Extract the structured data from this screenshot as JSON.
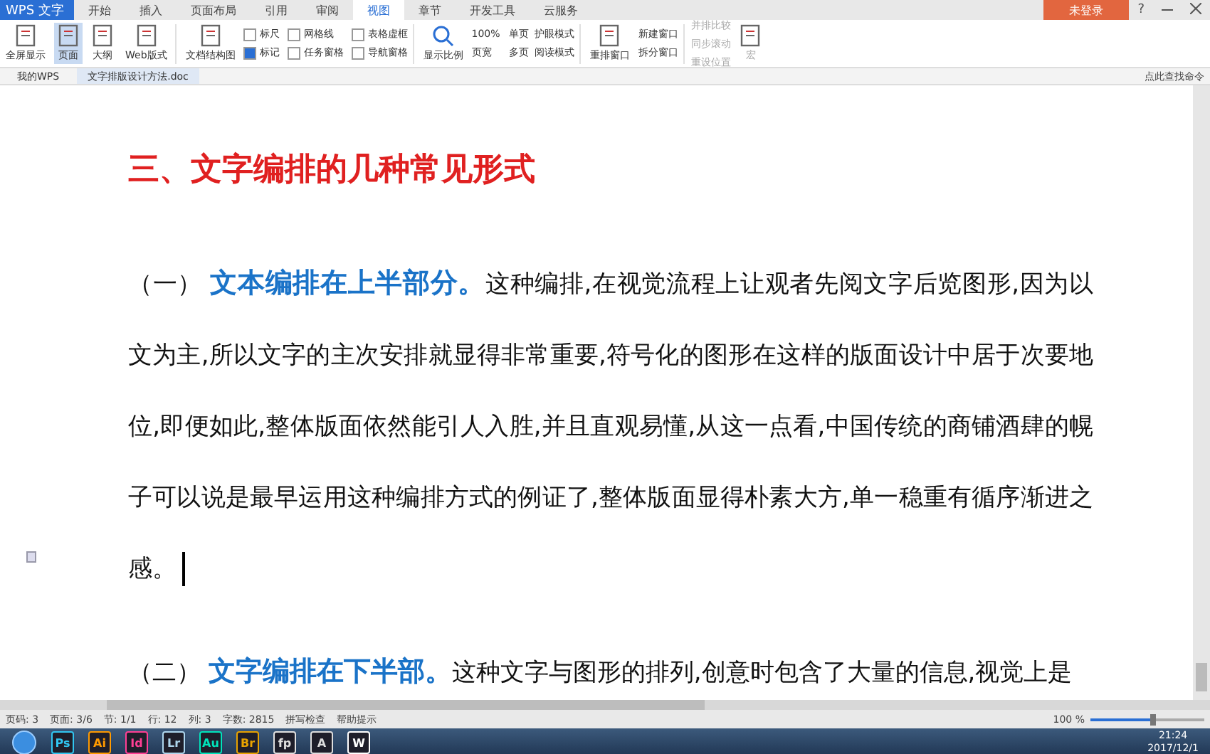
{
  "title_bar": {
    "app_button": "WPS 文字",
    "menu_tabs": [
      {
        "label": "开始",
        "selected": false
      },
      {
        "label": "插入",
        "selected": false
      },
      {
        "label": "页面布局",
        "selected": false
      },
      {
        "label": "引用",
        "selected": false
      },
      {
        "label": "审阅",
        "selected": false
      },
      {
        "label": "视图",
        "selected": true
      },
      {
        "label": "章节",
        "selected": false
      },
      {
        "label": "开发工具",
        "selected": false
      },
      {
        "label": "云服务",
        "selected": false
      }
    ],
    "login_button": "未登录",
    "help": "?"
  },
  "ribbon": {
    "view_buttons": [
      {
        "label": "全屏显示",
        "selected": false
      },
      {
        "label": "页面",
        "selected": true
      },
      {
        "label": "大纲",
        "selected": false
      },
      {
        "label": "Web版式",
        "selected": false
      }
    ],
    "doc_map": "文档结构图",
    "checkboxes": [
      {
        "label": "标尺",
        "checked": false
      },
      {
        "label": "网格线",
        "checked": false
      },
      {
        "label": "表格虚框",
        "checked": false
      },
      {
        "label": "标记",
        "checked": true
      },
      {
        "label": "任务窗格",
        "checked": false
      },
      {
        "label": "导航窗格",
        "checked": false
      }
    ],
    "zoom_button": "显示比例",
    "zoom_items": [
      "100%",
      "单页",
      "页宽",
      "多页"
    ],
    "modes": [
      "护眼模式",
      "阅读模式"
    ],
    "rearrange": "重排窗口",
    "window_items": [
      "新建窗口",
      "拆分窗口"
    ],
    "compare_items": [
      {
        "label": "并排比较",
        "disabled": true
      },
      {
        "label": "同步滚动",
        "disabled": true
      },
      {
        "label": "重设位置",
        "disabled": true
      }
    ],
    "macro": {
      "label": "宏",
      "disabled": true
    }
  },
  "doc_tabs": [
    {
      "label": "我的WPS",
      "selected": false
    },
    {
      "label": "文字排版设计方法.doc",
      "selected": true
    }
  ],
  "command_search": "点此查找命令",
  "document": {
    "heading": "三、文字编排的几种常见形式",
    "paragraph": "（一） **文本编排在上半部分。**这种编排,在视觉流程上让观者先阅文字后览图形,因为以文为主,所以文字的主次安排就显得非常重要,符号化的图形在这样的版面设计中居于次要地位,即便如此,整体版面依然能引人入胜,并且直观易懂,从这一点看,中国传统的商铺酒肆的幌子可以说是最早运用这种编排方式的例证了,整体版面显得朴素大方,单一稳重有循序渐进之感。",
    "next_paragraph": "（二） **文字编排在下半部。**这种文字与图形的排列,创意时包含了大量的信息,视觉上是"
  },
  "status_bar": {
    "items": [
      "页码: 3",
      "页面: 3/6",
      "节: 1/1",
      "行: 12",
      "列: 3",
      "字数: 2815",
      "拼写检查",
      "帮助提示"
    ],
    "zoom": "100 %",
    "zoom_slider": {
      "level": 0.55
    }
  },
  "taskbar": {
    "apps": [
      {
        "label": "Ps",
        "color": "#31c5f0"
      },
      {
        "label": "Ai",
        "color": "#ff9a00"
      },
      {
        "label": "Id",
        "color": "#ff3f94"
      },
      {
        "label": "Lr",
        "color": "#add5ec"
      },
      {
        "label": "Au",
        "color": "#00e4bb"
      },
      {
        "label": "Br",
        "color": "#e8a200"
      },
      {
        "label": "fp",
        "color": "#e0e0e0"
      },
      {
        "label": "A",
        "color": "#dddddd"
      },
      {
        "label": "W",
        "color": "#ffffff"
      }
    ],
    "time": "21:24",
    "date": "2017/12/1"
  }
}
